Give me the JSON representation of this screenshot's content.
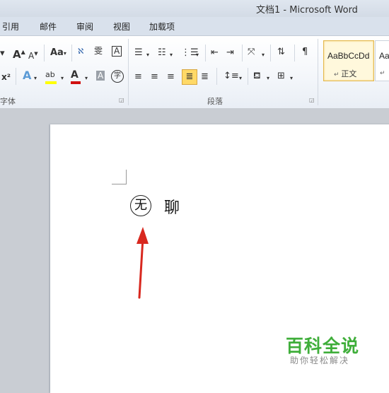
{
  "window": {
    "title": "文档1 - Microsoft Word"
  },
  "tabs": [
    "引用",
    "邮件",
    "审阅",
    "视图",
    "加载项"
  ],
  "ribbon": {
    "font_group_label": "字体",
    "paragraph_group_label": "段落",
    "grow_font": "A",
    "shrink_font": "A",
    "change_case": "Aa",
    "superscript": "x²",
    "char_border": "A",
    "enclose_char": "字",
    "styles": [
      {
        "preview": "AaBbCcDd",
        "name": "正文",
        "selected": true
      },
      {
        "preview": "Aa",
        "name": "",
        "selected": false
      }
    ]
  },
  "document": {
    "circled_char": "无",
    "text": "聊"
  },
  "watermark": {
    "title": "百科全说",
    "subtitle": "助你轻松解决"
  },
  "colors": {
    "highlight": "#ffff00",
    "font_color": "#d01010",
    "annotation_arrow": "#d8281f",
    "watermark_green": "#3fae3a"
  }
}
